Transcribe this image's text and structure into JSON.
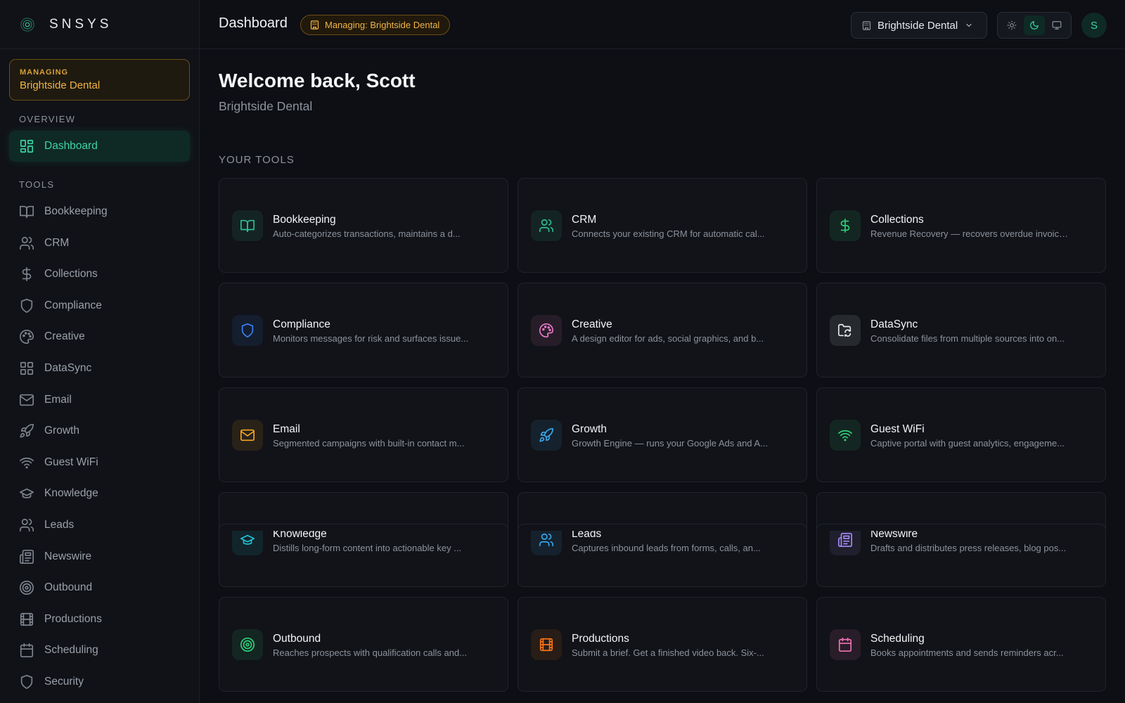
{
  "brand": {
    "name": "SNSYS"
  },
  "sidebar": {
    "managing_label": "MANAGING",
    "managing_value": "Brightside Dental",
    "overview_label": "OVERVIEW",
    "tools_label": "TOOLS",
    "items": [
      {
        "label": "Dashboard",
        "icon": "dashboard-icon"
      },
      {
        "label": "Bookkeeping",
        "icon": "book-icon"
      },
      {
        "label": "CRM",
        "icon": "users-icon"
      },
      {
        "label": "Collections",
        "icon": "dollar-icon"
      },
      {
        "label": "Compliance",
        "icon": "shield-icon"
      },
      {
        "label": "Creative",
        "icon": "palette-icon"
      },
      {
        "label": "DataSync",
        "icon": "grid-icon"
      },
      {
        "label": "Email",
        "icon": "mail-icon"
      },
      {
        "label": "Growth",
        "icon": "rocket-icon"
      },
      {
        "label": "Guest WiFi",
        "icon": "wifi-icon"
      },
      {
        "label": "Knowledge",
        "icon": "graduation-cap-icon"
      },
      {
        "label": "Leads",
        "icon": "users-icon"
      },
      {
        "label": "Newswire",
        "icon": "newspaper-icon"
      },
      {
        "label": "Outbound",
        "icon": "target-icon"
      },
      {
        "label": "Productions",
        "icon": "film-icon"
      },
      {
        "label": "Scheduling",
        "icon": "calendar-icon"
      },
      {
        "label": "Security",
        "icon": "shield-icon"
      }
    ]
  },
  "header": {
    "title": "Dashboard",
    "managing_pill": "Managing: Brightside Dental",
    "org_select": "Brightside Dental",
    "avatar_initial": "S"
  },
  "main": {
    "welcome": "Welcome back, Scott",
    "subtitle": "Brightside Dental",
    "tools_label": "YOUR TOOLS",
    "tools": [
      {
        "title": "Bookkeeping",
        "desc": "Auto-categorizes transactions, maintains a d...",
        "icon": "book-icon",
        "color": "#2fbf8f"
      },
      {
        "title": "CRM",
        "desc": "Connects your existing CRM for automatic cal...",
        "icon": "users-icon",
        "color": "#2fbf8f"
      },
      {
        "title": "Collections",
        "desc": "Revenue Recovery — recovers overdue invoice...",
        "icon": "dollar-icon",
        "color": "#2fd07a"
      },
      {
        "title": "Compliance",
        "desc": "Monitors messages for risk and surfaces issue...",
        "icon": "shield-icon",
        "color": "#3b82f6"
      },
      {
        "title": "Creative",
        "desc": "A design editor for ads, social graphics, and b...",
        "icon": "palette-icon",
        "color": "#e879c9"
      },
      {
        "title": "DataSync",
        "desc": "Consolidate files from multiple sources into on...",
        "icon": "folder-sync-icon",
        "color": "#e6e8ec"
      },
      {
        "title": "Email",
        "desc": "Segmented campaigns with built-in contact m...",
        "icon": "mail-icon",
        "color": "#f5a623"
      },
      {
        "title": "Growth",
        "desc": "Growth Engine — runs your Google Ads and A...",
        "icon": "rocket-icon",
        "color": "#38a8f0"
      },
      {
        "title": "Guest WiFi",
        "desc": "Captive portal with guest analytics, engageme...",
        "icon": "wifi-icon",
        "color": "#2fd07a"
      },
      {
        "title": "Knowledge",
        "desc": "Distills long-form content into actionable key ...",
        "icon": "graduation-cap-icon",
        "color": "#22c3d6"
      },
      {
        "title": "Leads",
        "desc": "Captures inbound leads from forms, calls, an...",
        "icon": "users-icon",
        "color": "#38a8f0"
      },
      {
        "title": "Newswire",
        "desc": "Drafts and distributes press releases, blog pos...",
        "icon": "newspaper-icon",
        "color": "#a78bfa"
      },
      {
        "title": "Outbound",
        "desc": "Reaches prospects with qualification calls and...",
        "icon": "target-icon",
        "color": "#2fd07a"
      },
      {
        "title": "Productions",
        "desc": "Submit a brief. Get a finished video back. Six-...",
        "icon": "film-icon",
        "color": "#f97316"
      },
      {
        "title": "Scheduling",
        "desc": "Books appointments and sends reminders acr...",
        "icon": "calendar-icon",
        "color": "#f472b6"
      }
    ]
  },
  "colors": {
    "accent": "#3ed4a4",
    "warning": "#f0b444",
    "background": "#0d0f14"
  }
}
